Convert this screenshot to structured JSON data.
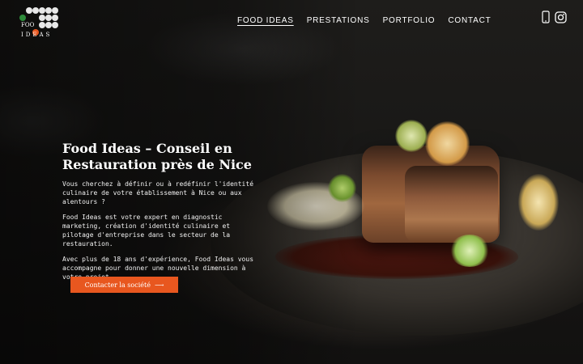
{
  "logo": {
    "text_top": "FOO",
    "text_bottom": "IDEAS"
  },
  "nav": [
    {
      "label": "FOOD IDEAS",
      "active": true
    },
    {
      "label": "PRESTATIONS",
      "active": false
    },
    {
      "label": "PORTFOLIO",
      "active": false
    },
    {
      "label": "CONTACT",
      "active": false
    }
  ],
  "header_icons": [
    "phone-icon",
    "instagram-icon"
  ],
  "hero": {
    "title": "Food Ideas – Conseil en Restauration près de Nice",
    "paragraphs": [
      "Vous cherchez à définir ou à redéfinir l'identité culinaire de votre établissement à Nice ou aux alentours ?",
      "Food Ideas est votre expert en diagnostic marketing, création d'identité culinaire et pilotage d'entreprise dans le secteur de la restauration.",
      "Avec plus de 18 ans d'expérience, Food Ideas vous accompagne pour donner une nouvelle dimension à votre projet."
    ],
    "cta_label": "Contacter la société",
    "cta_arrow": "⟶"
  },
  "colors": {
    "accent": "#e8571f",
    "text": "#ffffff"
  }
}
